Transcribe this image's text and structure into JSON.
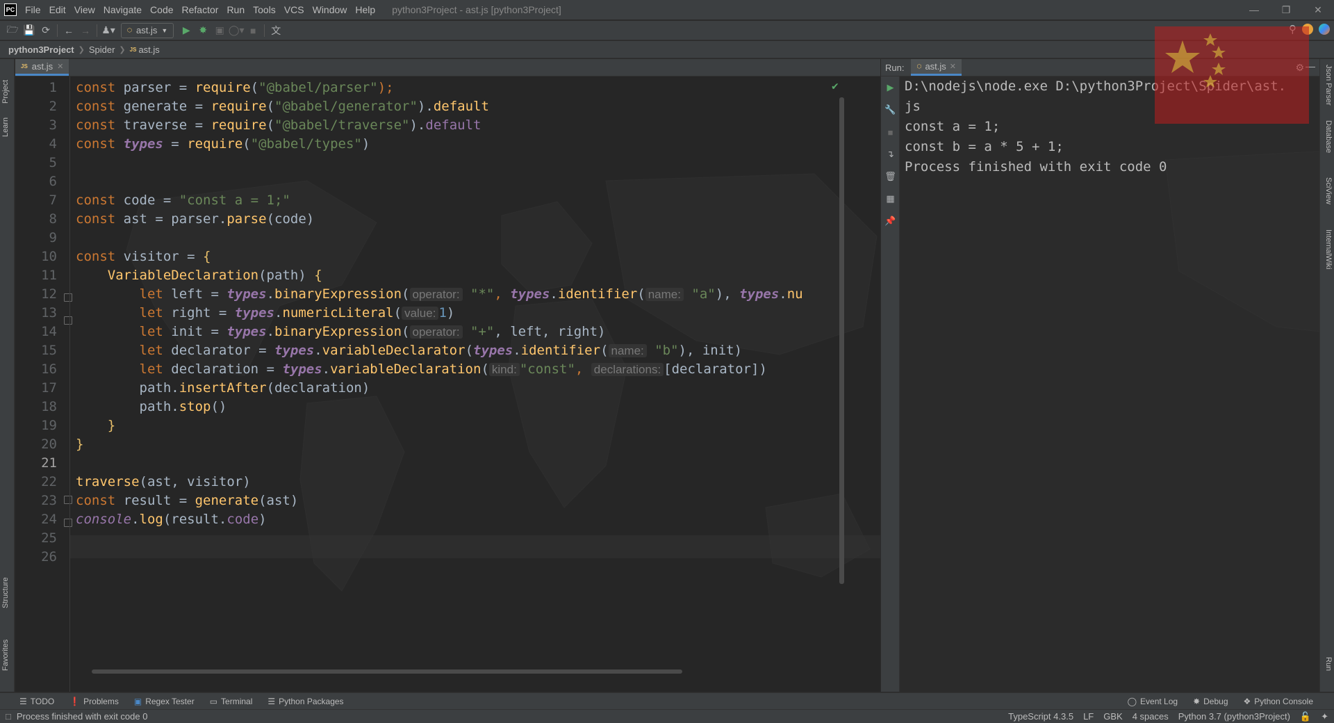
{
  "menu": [
    "File",
    "Edit",
    "View",
    "Navigate",
    "Code",
    "Refactor",
    "Run",
    "Tools",
    "VCS",
    "Window",
    "Help"
  ],
  "window_title": "python3Project - ast.js [python3Project]",
  "app_logo": "PC",
  "toolbar": {
    "run_config": "ast.js"
  },
  "breadcrumb": [
    "python3Project",
    "Spider",
    "ast.js"
  ],
  "left_strip": [
    "Project",
    "Learn",
    "Structure",
    "Favorites"
  ],
  "right_strip": [
    "Json Parser",
    "Database",
    "SciView",
    "InternalWiki",
    "Run"
  ],
  "editor": {
    "tab": "ast.js",
    "line_numbers": [
      "1",
      "2",
      "3",
      "4",
      "5",
      "6",
      "7",
      "8",
      "9",
      "10",
      "11",
      "12",
      "13",
      "14",
      "15",
      "16",
      "17",
      "18",
      "19",
      "20",
      "21",
      "22",
      "23",
      "24",
      "25",
      "26"
    ],
    "current_line": "21"
  },
  "code": {
    "l1": [
      "const",
      " parser = ",
      "require",
      "(",
      "\"@babel/parser\"",
      ");"
    ],
    "l2": [
      "const",
      " generate = ",
      "require",
      "(",
      "\"@babel/generator\"",
      ").",
      "default"
    ],
    "l3": [
      "const",
      " traverse = ",
      "require",
      "(",
      "\"@babel/traverse\"",
      ").",
      "default"
    ],
    "l4": [
      "const",
      " ",
      "types",
      " = ",
      "require",
      "(",
      "\"@babel/types\"",
      ")"
    ],
    "l7": [
      "const",
      " code = ",
      "\"const a = 1;\""
    ],
    "l8": [
      "const",
      " ast = parser.",
      "parse",
      "(code)"
    ],
    "l10": [
      "const",
      " visitor = ",
      "{"
    ],
    "l11": [
      "VariableDeclaration",
      "(path) ",
      "{"
    ],
    "l12": [
      "let",
      " left = ",
      "types",
      ".",
      "binaryExpression",
      "(",
      "operator:",
      "\"*\"",
      ", ",
      "types",
      ".",
      "identifier",
      "(",
      "name:",
      "\"a\"",
      "), ",
      "types",
      ".",
      "nu"
    ],
    "l13": [
      "let",
      " right = ",
      "types",
      ".",
      "numericLiteral",
      "(",
      "value:",
      "1",
      ")"
    ],
    "l14": [
      "let",
      " init = ",
      "types",
      ".",
      "binaryExpression",
      "(",
      "operator:",
      "\"+\"",
      ", left, right)"
    ],
    "l15": [
      "let",
      " declarator = ",
      "types",
      ".",
      "variableDeclarator",
      "(",
      "types",
      ".",
      "identifier",
      "(",
      "name:",
      "\"b\"",
      "), init)"
    ],
    "l16": [
      "let",
      " declaration = ",
      "types",
      ".",
      "variableDeclaration",
      "(",
      "kind:",
      "\"const\"",
      ", ",
      "declarations:",
      "[declarator])"
    ],
    "l17": [
      "path.",
      "insertAfter",
      "(declaration)"
    ],
    "l18": [
      "path.",
      "stop",
      "()"
    ],
    "l19": [
      "}"
    ],
    "l20": [
      "}"
    ],
    "l22": [
      "traverse",
      "(ast, visitor)"
    ],
    "l23": [
      "const",
      " result = ",
      "generate",
      "(ast)"
    ],
    "l24": [
      "console",
      ".",
      "log",
      "(result.",
      "code",
      ")"
    ]
  },
  "run_panel": {
    "label": "Run:",
    "tab": "ast.js",
    "console": [
      "D:\\nodejs\\node.exe D:\\python3Project\\Spider\\ast.",
      "js",
      "const a = 1;",
      "const b = a * 5 + 1;",
      "Process finished with exit code 0"
    ]
  },
  "bottom_tools": [
    "TODO",
    "Problems",
    "Regex Tester",
    "Terminal",
    "Python Packages"
  ],
  "bottom_tools_right": [
    "Event Log",
    "Debug",
    "Python Console"
  ],
  "status": {
    "message": "Process finished with exit code 0",
    "typescript": "TypeScript 4.3.5",
    "line_sep": "LF",
    "encoding": "GBK",
    "indent": "4 spaces",
    "interpreter": "Python 3.7 (python3Project)"
  },
  "colors": {
    "keyword": "#cc7832",
    "string": "#6a8759",
    "function": "#ffc66d",
    "property": "#9876aa",
    "number": "#6897bb",
    "run_green": "#59a869"
  }
}
